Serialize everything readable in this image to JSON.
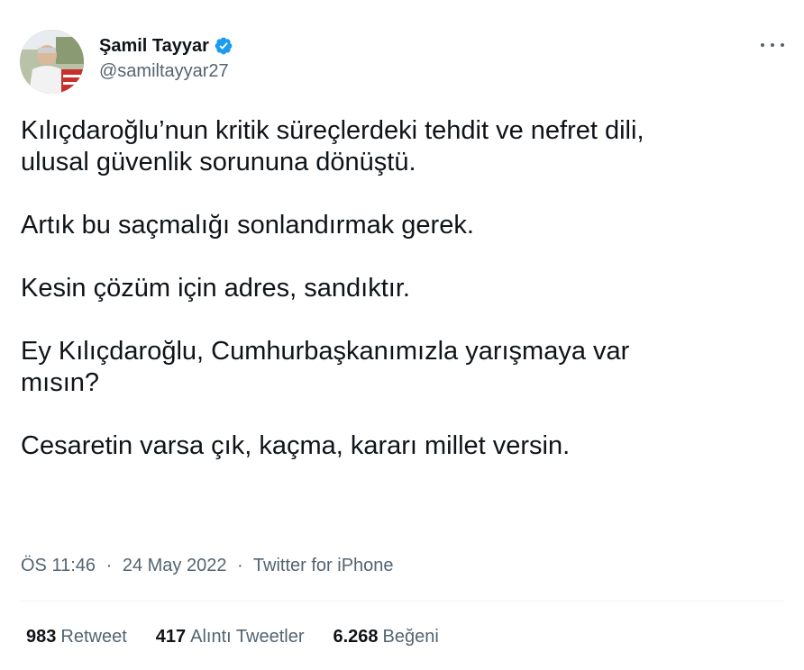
{
  "author": {
    "display_name": "Şamil Tayyar",
    "handle": "@samiltayyar27",
    "verified_color": "#1d9bf0"
  },
  "tweet": {
    "paragraphs": [
      "Kılıçdaroğlu’nun kritik süreçlerdeki tehdit ve nefret dili,\nulusal güvenlik sorununa dönüştü.",
      "Artık bu saçmalığı sonlandırmak gerek.",
      "Kesin çözüm için adres, sandıktır.",
      "Ey Kılıçdaroğlu, Cumhurbaşkanımızla yarışmaya var\nmısın?",
      "Cesaretin varsa çık, kaçma, kararı millet versin."
    ],
    "time": "ÖS 11:46",
    "date": "24 May 2022",
    "source": "Twitter for iPhone",
    "separator": "·"
  },
  "stats": {
    "retweets": {
      "count": "983",
      "label": "Retweet"
    },
    "quotes": {
      "count": "417",
      "label": "Alıntı Tweetler"
    },
    "likes": {
      "count": "6.268",
      "label": "Beğeni"
    }
  },
  "icons": {
    "more": "more-horizontal-icon",
    "verified": "verified-badge-icon"
  }
}
